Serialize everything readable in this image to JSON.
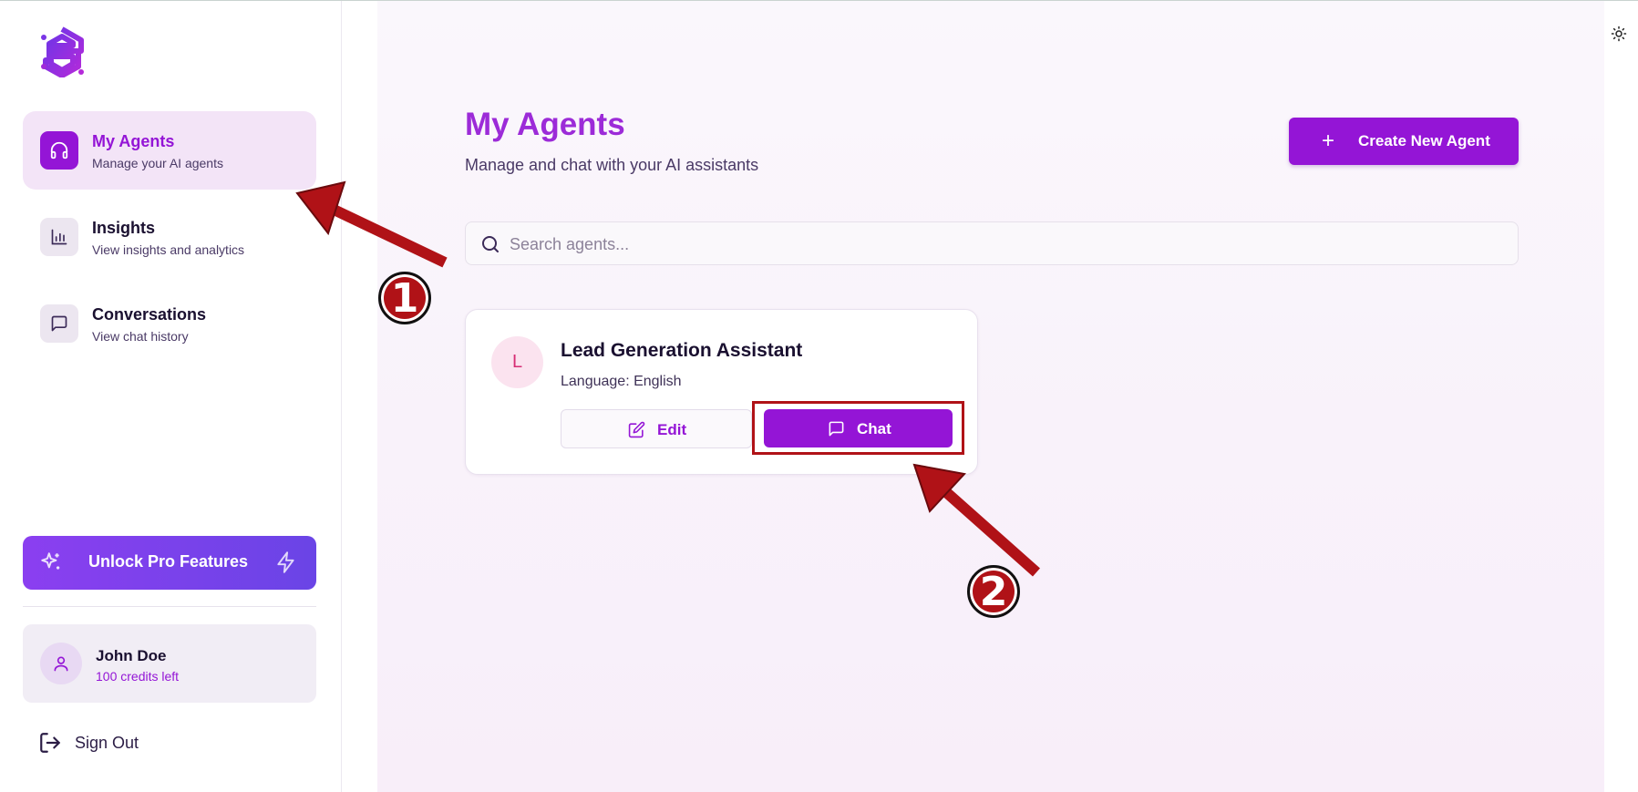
{
  "sidebar": {
    "nav": [
      {
        "title": "My Agents",
        "subtitle": "Manage your AI agents",
        "icon": "headphones-icon",
        "active": true
      },
      {
        "title": "Insights",
        "subtitle": "View insights and analytics",
        "icon": "bar-chart-icon",
        "active": false
      },
      {
        "title": "Conversations",
        "subtitle": "View chat history",
        "icon": "message-square-icon",
        "active": false
      }
    ],
    "pro_label": "Unlock Pro Features",
    "user": {
      "name": "John Doe",
      "credits": "100 credits left"
    },
    "signout_label": "Sign Out"
  },
  "main": {
    "title": "My Agents",
    "subtitle": "Manage and chat with your AI assistants",
    "create_label": "Create New Agent",
    "create_plus": "+",
    "search_placeholder": "Search agents...",
    "agent": {
      "initial": "L",
      "name": "Lead Generation Assistant",
      "language": "Language: English",
      "edit_label": "Edit",
      "chat_label": "Chat"
    }
  },
  "annotations": {
    "badge_1": "1",
    "badge_2": "2"
  },
  "colors": {
    "accent": "#9415d6",
    "annotation": "#b01217"
  }
}
